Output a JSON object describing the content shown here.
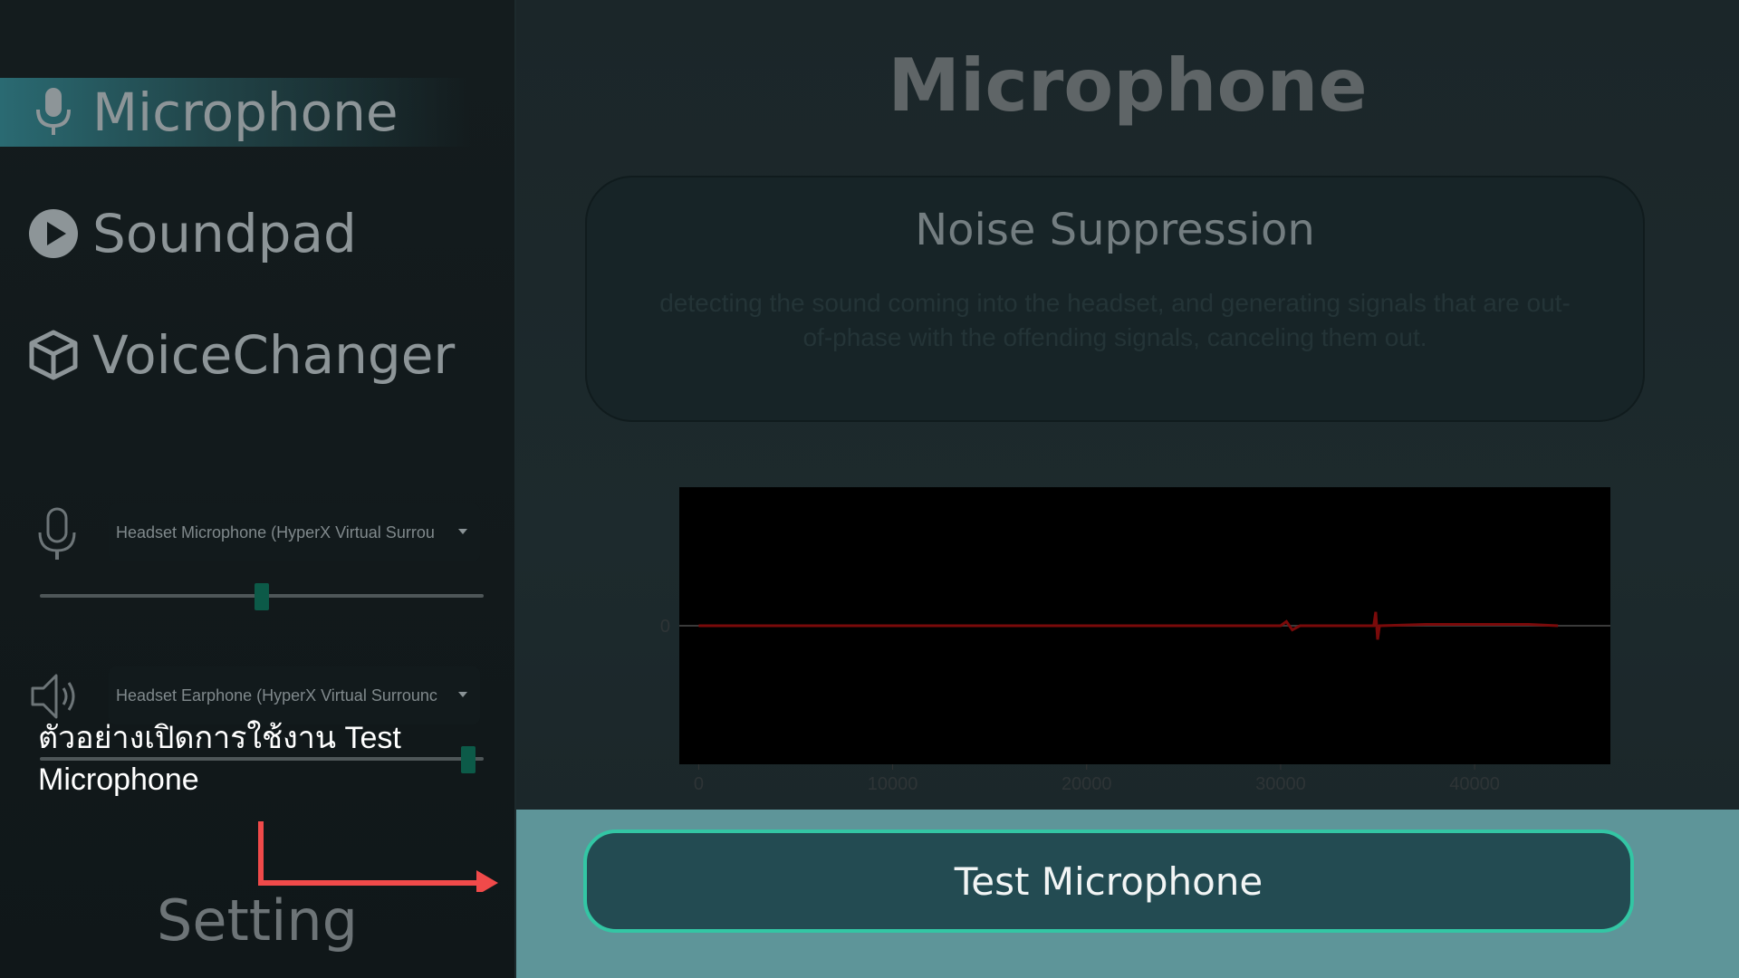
{
  "sidebar": {
    "items": [
      {
        "label": "Microphone",
        "icon": "microphone-icon",
        "active": true
      },
      {
        "label": "Soundpad",
        "icon": "play-circle-icon",
        "active": false
      },
      {
        "label": "VoiceChanger",
        "icon": "cube-icon",
        "active": false
      }
    ],
    "input_device": {
      "icon": "microphone-outline-icon",
      "value": "Headset Microphone (HyperX Virtual Surrou",
      "volume": 0.5
    },
    "output_device": {
      "icon": "speaker-icon",
      "value": "Headset Earphone (HyperX Virtual Surrounc",
      "volume": 0.98
    },
    "setting_label": "Setting"
  },
  "annotation": {
    "text": "ตัวอย่างเปิดการใช้งาน Test Microphone",
    "arrow_color": "#f04a4a"
  },
  "main": {
    "title": "Microphone",
    "noise_card": {
      "title": "Noise Suppression",
      "description": "detecting the sound coming into the headset, and generating signals that are  out-of-phase with the  offending signals, canceling them out."
    },
    "test_button": "Test Microphone"
  },
  "colors": {
    "accent": "#33c6a4",
    "waveform": "#7a0a0a",
    "band": "#5e9599"
  },
  "chart_data": {
    "type": "line",
    "title": "",
    "xlabel": "",
    "ylabel": "",
    "xlim": [
      -1000,
      47000
    ],
    "ylim": [
      -1,
      1
    ],
    "x_ticks": [
      0,
      10000,
      20000,
      30000,
      40000
    ],
    "y_ticks": [
      0
    ],
    "series": [
      {
        "x": [
          0,
          30000,
          30300,
          30600,
          31000,
          34800,
          34900,
          35000,
          35100,
          37500,
          40800,
          42800,
          44300
        ],
        "y": [
          0,
          0,
          0.03,
          -0.03,
          0,
          0,
          0.1,
          -0.1,
          0,
          0.01,
          0.01,
          0.01,
          0
        ]
      }
    ]
  }
}
